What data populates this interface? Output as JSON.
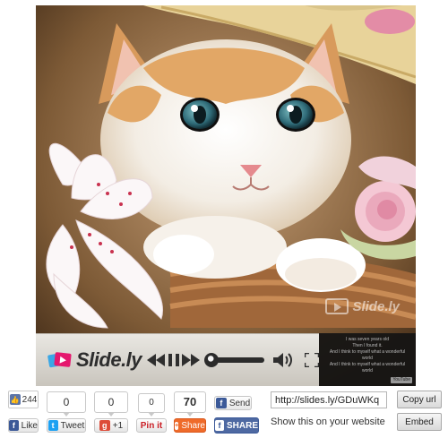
{
  "player": {
    "brand_name": "Slide.ly",
    "overlay_watermark": "Slide.ly",
    "caption_lines": [
      "I was seven years old",
      "Then I found it.",
      "",
      "And I think to myself what a wonderful world",
      "",
      "And I think to myself what a wonderful world"
    ],
    "caption_badge": "YouTube",
    "progress": 0.06,
    "controls": [
      "prev-icon",
      "pause-icon",
      "next-icon",
      "seek-bar",
      "volume-icon",
      "fullscreen-icon"
    ]
  },
  "social": {
    "facebook_like": {
      "count": "244",
      "label": "Like"
    },
    "twitter": {
      "count": "0",
      "label": "Tweet"
    },
    "google_plus": {
      "count": "0",
      "label": "+1"
    },
    "pinterest": {
      "count": "0",
      "label": "Pin it"
    },
    "share": {
      "count": "70",
      "label": "Share"
    },
    "facebook_send": {
      "label": "Send"
    },
    "facebook_share": {
      "label": "SHARE"
    }
  },
  "embed": {
    "url": "http://slides.ly/GDuWKq",
    "copy_label": "Copy url",
    "show_label": "Show this on your website",
    "embed_label": "Embed"
  },
  "colors": {
    "facebook": "#3b5998",
    "twitter": "#1da1f2",
    "google": "#dd4b39",
    "pinterest": "#cb2027",
    "share_orange": "#ef6b2a",
    "brand_pink": "#e5186e",
    "brand_blue": "#3aa7e6"
  }
}
